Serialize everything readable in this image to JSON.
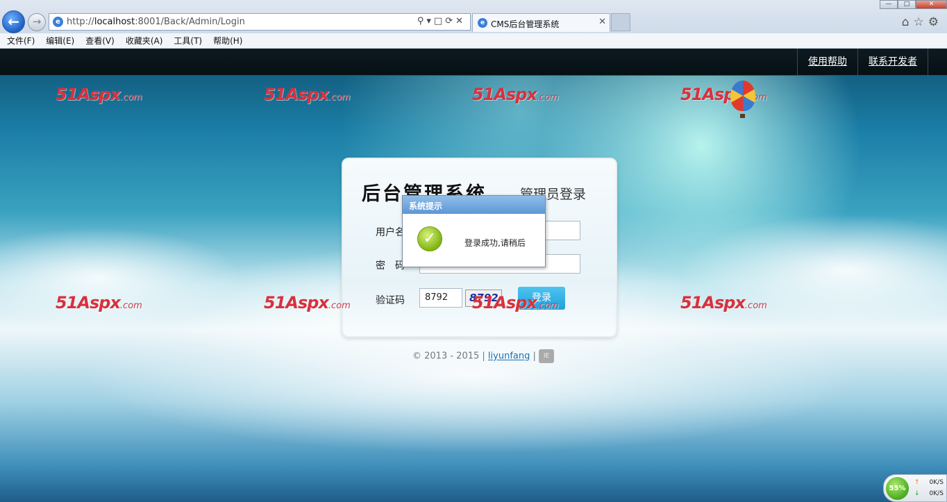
{
  "browser": {
    "url_prefix": "http://",
    "url_host": "localhost",
    "url_rest": ":8001/Back/Admin/Login",
    "tab_title": "CMS后台管理系统",
    "menu": [
      "文件(F)",
      "编辑(E)",
      "查看(V)",
      "收藏夹(A)",
      "工具(T)",
      "帮助(H)"
    ]
  },
  "header": {
    "help_link": "使用帮助",
    "contact_link": "联系开发者"
  },
  "watermark": {
    "main": "51Aspx",
    "suffix": ".com"
  },
  "login": {
    "system_title": "后台管理系统",
    "subtitle": "管理员登录",
    "username_label": "用户名",
    "password_label": "密　码",
    "captcha_label": "验证码",
    "captcha_input": "8792",
    "captcha_image": "8792",
    "login_button": "登录"
  },
  "footer": {
    "copyright": "© 2013 - 2015 |",
    "author": "liyunfang",
    "separator": "|"
  },
  "dialog": {
    "title": "系统提示",
    "message": "登录成功,请稍后"
  },
  "net_widget": {
    "percent": "55%",
    "up": "0K/S",
    "down": "0K/S"
  },
  "colors": {
    "accent": "#1ea2dd",
    "watermark": "#d8313d",
    "dialog_header": "#5c97d6"
  }
}
